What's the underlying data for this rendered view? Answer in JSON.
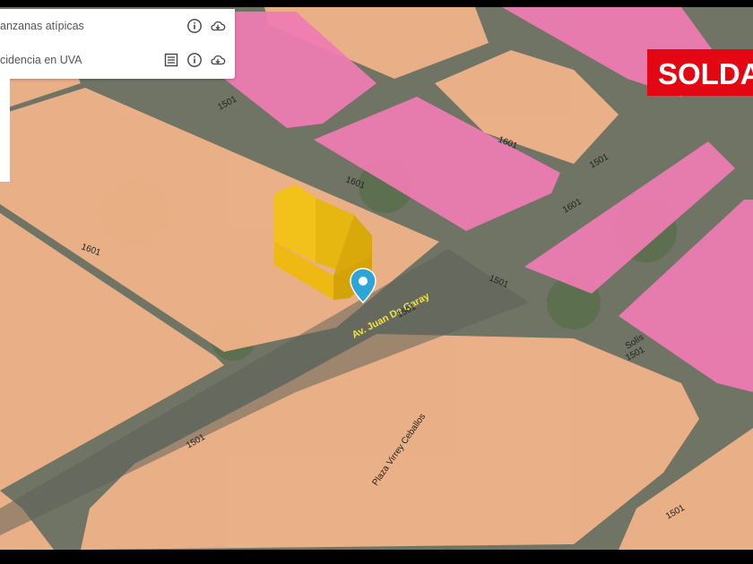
{
  "layers_panel": {
    "rows": [
      {
        "label": "anzanas atípicas",
        "icons": [
          "info-icon",
          "cloud-download-icon"
        ]
      },
      {
        "label": "cidencia en UVA",
        "icons": [
          "list-icon",
          "info-icon",
          "cloud-download-icon"
        ]
      }
    ]
  },
  "brand": {
    "text": "SOLDA"
  },
  "map": {
    "street_labels": [
      "Av. Juan De Garay"
    ],
    "park_labels": [
      "Plaza Virrey Ceballos"
    ],
    "block_labels": [
      "1501",
      "1501",
      "1501",
      "1501",
      "1601",
      "1601",
      "1601",
      "1501",
      "1601",
      "1501",
      "1501"
    ],
    "side_street_label": "Solís",
    "colors": {
      "block_orange": "#f4b58a",
      "block_pink": "#f07cb3",
      "building_yellow": "#f2c21a",
      "marker": "#2fa4d8",
      "brand_red": "#e30613"
    }
  }
}
